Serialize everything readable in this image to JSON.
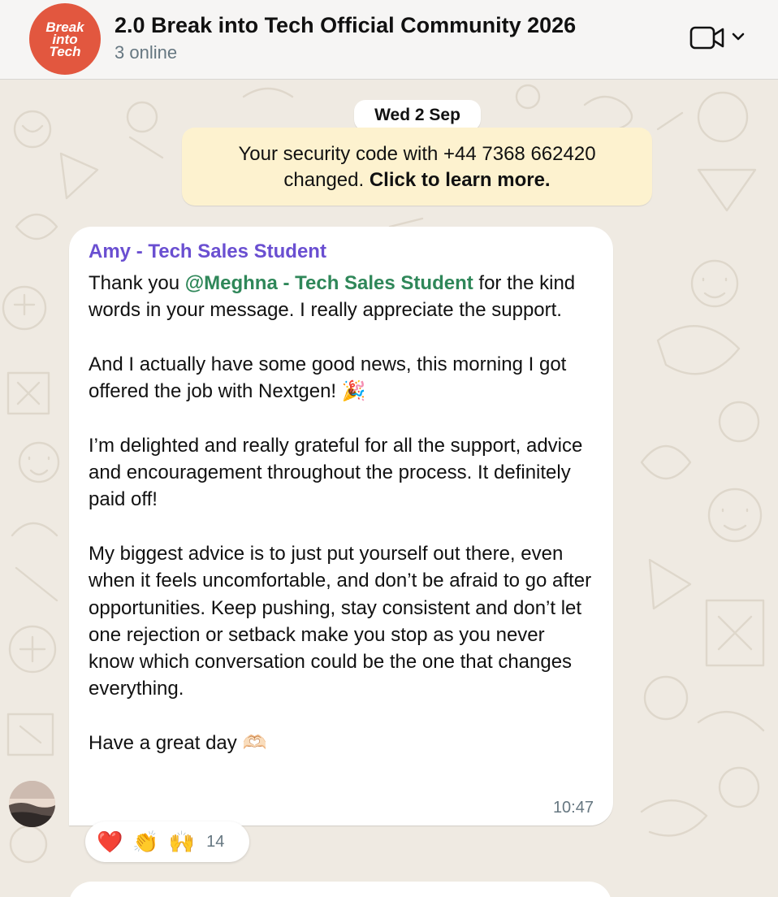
{
  "header": {
    "logo_lines": [
      "Break",
      "into",
      "Tech"
    ],
    "title": "2.0 Break into Tech Official Community 2026",
    "subtitle": "3 online",
    "video_icon": "video-camera-icon",
    "chevron_icon": "chevron-down-icon"
  },
  "chat": {
    "date": "Wed 2 Sep",
    "system_message": {
      "text": "Your security code with +44 7368 662420 changed.",
      "link": "Click to learn more."
    },
    "message": {
      "sender": "Amy - Tech Sales Student",
      "thanks_prefix": "Thank you ",
      "mention": "@Meghna - Tech Sales Student",
      "thanks_suffix": " for the kind words in your message. I really appreciate the support.",
      "p2": "And I actually have some good news, this morning I got offered the job with Nextgen! 🎉",
      "p3": "I’m delighted and really grateful for all the support, advice and encouragement throughout the process. It definitely paid off!",
      "p4": "My biggest advice is to just put yourself out there, even when it feels uncomfortable, and don’t be afraid to go after opportunities. Keep pushing, stay consistent and don’t let one rejection or setback make you stop as you never know which conversation could be the one that changes everything.",
      "p5": "Have a great day 🫶🏻",
      "time": "10:47"
    },
    "reactions": {
      "emojis": [
        "❤️",
        "👏",
        "🙌"
      ],
      "count": "14"
    }
  },
  "colors": {
    "logo_bg": "#e2573f",
    "sender": "#6a4fd1",
    "mention": "#2f8759",
    "system_bg": "#fdf2cf",
    "chat_bg": "#efeae2"
  }
}
